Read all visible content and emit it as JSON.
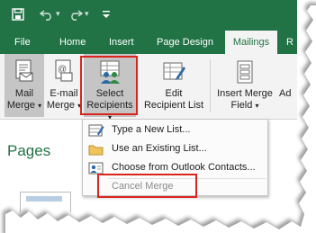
{
  "quick_access": {
    "save_icon": "save-icon",
    "undo_icon": "undo-icon",
    "redo_icon": "redo-icon",
    "customize_icon": "customize-qat-icon"
  },
  "tabs": [
    {
      "label": "File"
    },
    {
      "label": "Home"
    },
    {
      "label": "Insert"
    },
    {
      "label": "Page Design"
    },
    {
      "label": "Mailings"
    },
    {
      "label": "R"
    }
  ],
  "ribbon": {
    "mail_merge": {
      "line1": "Mail",
      "line2": "Merge"
    },
    "email_merge": {
      "line1": "E-mail",
      "line2": "Merge"
    },
    "select_recipients": {
      "line1": "Select",
      "line2": "Recipients"
    },
    "edit_recipient_list": {
      "line1": "Edit",
      "line2": "Recipient List"
    },
    "insert_merge_field": {
      "line1": "Insert Merge",
      "line2": "Field"
    },
    "partial": {
      "line1": "Ad"
    },
    "dropdown_arrow": "▾"
  },
  "pane": {
    "title": "Pages"
  },
  "menu": {
    "items": [
      {
        "label": "Type a New List...",
        "icon": "new-list-icon",
        "enabled": true
      },
      {
        "label": "Use an Existing List...",
        "icon": "existing-list-icon",
        "enabled": true
      },
      {
        "label": "Choose from Outlook Contacts...",
        "icon": "outlook-contacts-icon",
        "enabled": true
      },
      {
        "label": "Cancel Merge",
        "icon": "",
        "enabled": false
      }
    ]
  },
  "colors": {
    "accent": "#217346",
    "highlight": "#d9251d"
  }
}
